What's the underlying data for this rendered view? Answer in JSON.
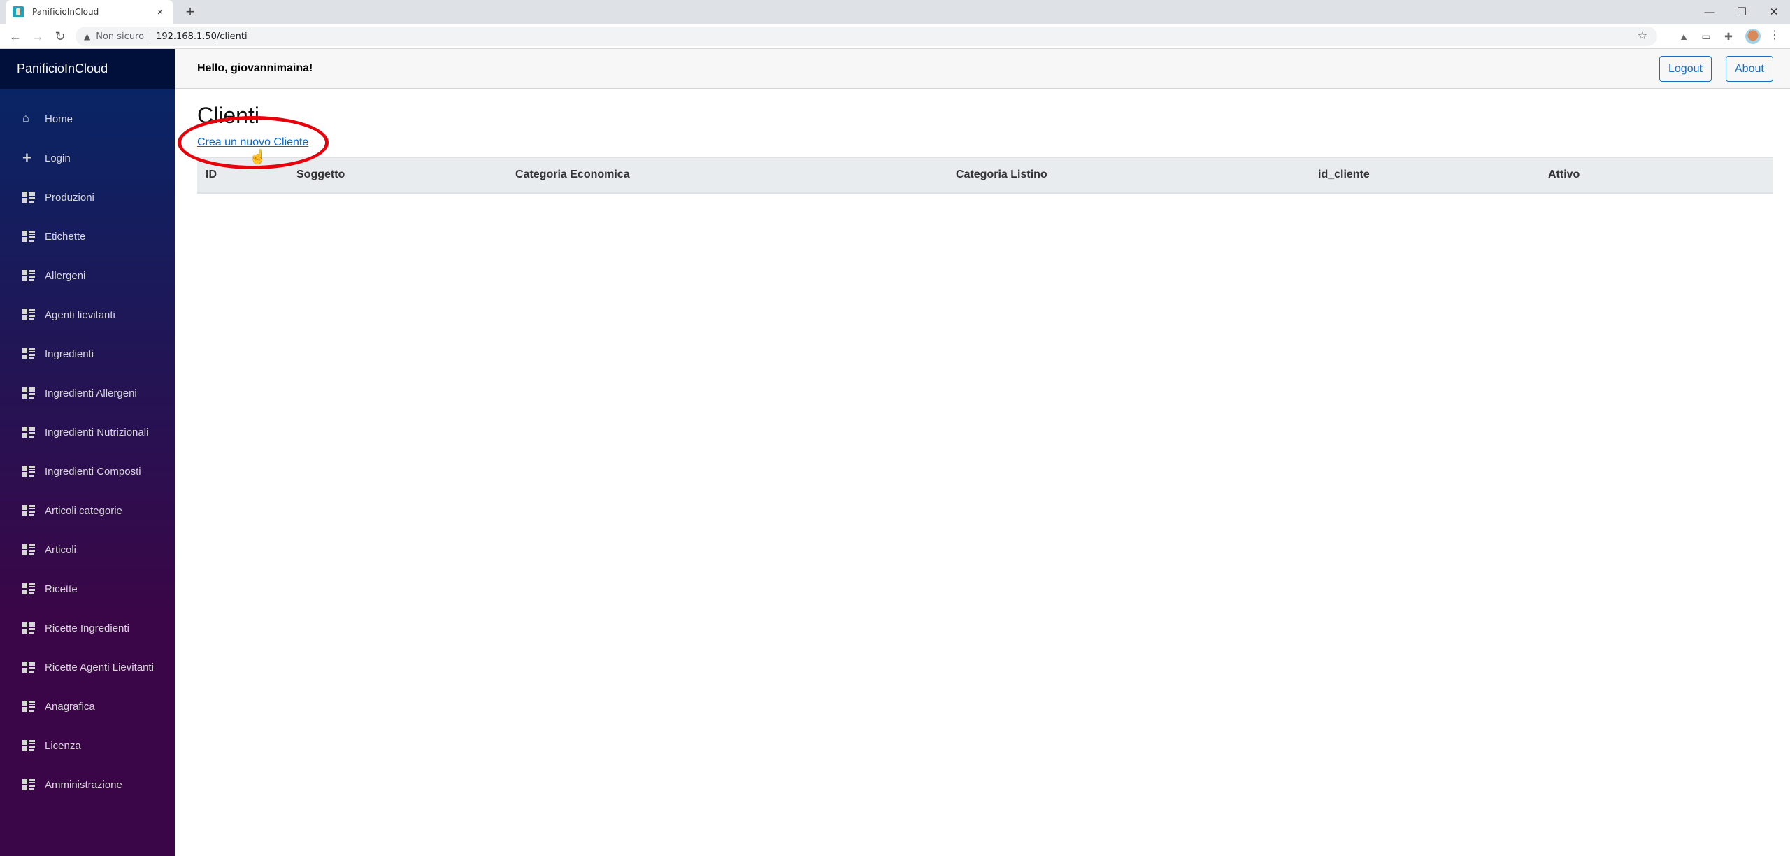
{
  "browser": {
    "tab_title": "PanificioInCloud",
    "new_tab": "+",
    "close_tab": "×",
    "security_label": "Non sicuro",
    "url": "192.168.1.50/clienti",
    "window_controls": {
      "minimize": "—",
      "restore": "❐",
      "close": "✕"
    }
  },
  "sidebar": {
    "brand": "PanificioInCloud",
    "items": [
      {
        "label": "Home",
        "icon": "home-icon"
      },
      {
        "label": "Login",
        "icon": "plus-icon"
      },
      {
        "label": "Produzioni",
        "icon": "list-icon"
      },
      {
        "label": "Etichette",
        "icon": "list-icon"
      },
      {
        "label": "Allergeni",
        "icon": "list-icon"
      },
      {
        "label": "Agenti lievitanti",
        "icon": "list-icon"
      },
      {
        "label": "Ingredienti",
        "icon": "list-icon"
      },
      {
        "label": "Ingredienti Allergeni",
        "icon": "list-icon"
      },
      {
        "label": "Ingredienti Nutrizionali",
        "icon": "list-icon"
      },
      {
        "label": "Ingredienti Composti",
        "icon": "list-icon"
      },
      {
        "label": "Articoli categorie",
        "icon": "list-icon"
      },
      {
        "label": "Articoli",
        "icon": "list-icon"
      },
      {
        "label": "Ricette",
        "icon": "list-icon"
      },
      {
        "label": "Ricette Ingredienti",
        "icon": "list-icon"
      },
      {
        "label": "Ricette Agenti Lievitanti",
        "icon": "list-icon"
      },
      {
        "label": "Anagrafica",
        "icon": "list-icon"
      },
      {
        "label": "Licenza",
        "icon": "list-icon"
      },
      {
        "label": "Amministrazione",
        "icon": "list-icon"
      }
    ]
  },
  "header": {
    "greeting": "Hello, giovannimaina!",
    "logout_label": "Logout",
    "about_label": "About"
  },
  "main": {
    "title": "Clienti",
    "create_link": "Crea un nuovo Cliente",
    "table": {
      "columns": [
        "ID",
        "Soggetto",
        "Categoria Economica",
        "Categoria Listino",
        "id_cliente",
        "Attivo"
      ],
      "rows": []
    }
  },
  "colors": {
    "accent": "#1b6ec2",
    "link": "#0366d6",
    "annotation": "#e8000b"
  }
}
